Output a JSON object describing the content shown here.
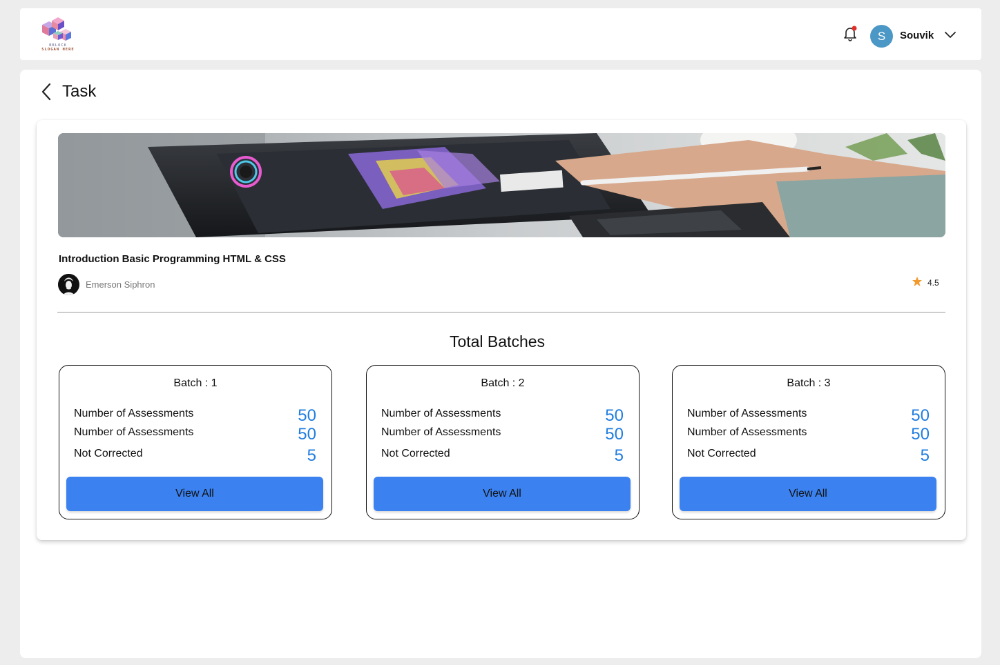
{
  "header": {
    "logo_line1": "BBLOCK",
    "logo_line2": "SLOGAN HERE",
    "avatar_initial": "S",
    "username": "Souvik",
    "notification_dot_color": "#e0302a"
  },
  "page": {
    "title": "Task"
  },
  "course": {
    "title": "Introduction Basic Programming HTML & CSS",
    "instructor": "Emerson Siphron",
    "rating": "4.5",
    "star_color": "#f39a2d"
  },
  "batches_section": {
    "title": "Total Batches",
    "batches": [
      {
        "title": "Batch : 1",
        "rows": [
          {
            "label": "Number of Assessments",
            "value": "50"
          },
          {
            "label": "Number of Assessments",
            "value": "50"
          },
          {
            "label": "Not Corrected",
            "value": "5"
          }
        ],
        "button": "View All"
      },
      {
        "title": "Batch : 2",
        "rows": [
          {
            "label": "Number of Assessments",
            "value": "50"
          },
          {
            "label": "Number of Assessments",
            "value": "50"
          },
          {
            "label": "Not Corrected",
            "value": "5"
          }
        ],
        "button": "View All"
      },
      {
        "title": "Batch : 3",
        "rows": [
          {
            "label": "Number of Assessments",
            "value": "50"
          },
          {
            "label": "Number of Assessments",
            "value": "50"
          },
          {
            "label": "Not Corrected",
            "value": "5"
          }
        ],
        "button": "View All"
      }
    ]
  },
  "colors": {
    "accent_button": "#3b82f0",
    "value_text": "#1f7de0",
    "avatar_bg": "#4b97c6"
  }
}
